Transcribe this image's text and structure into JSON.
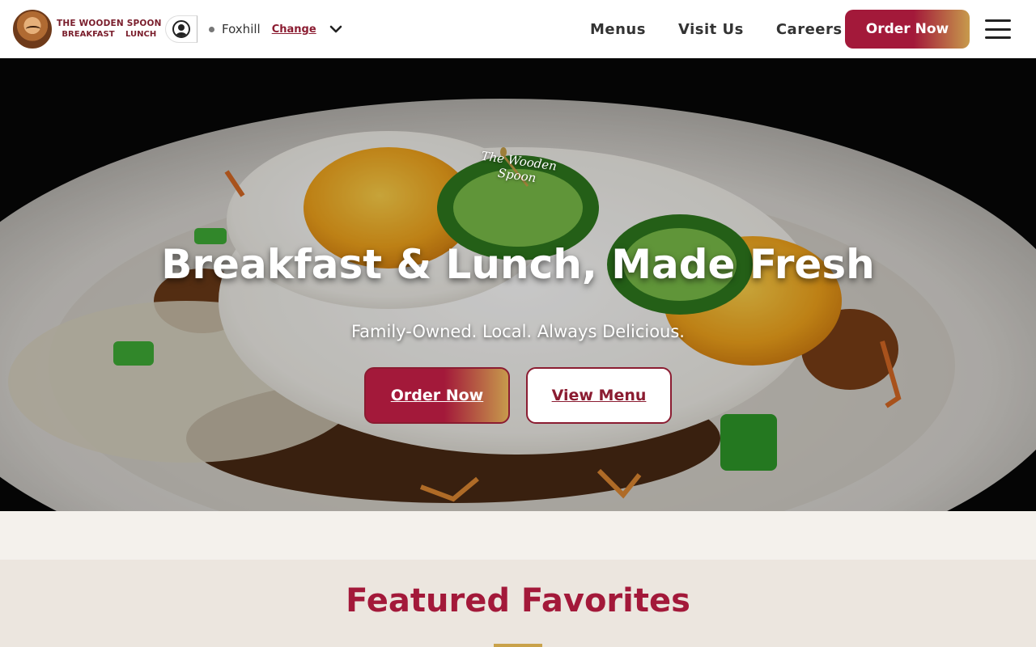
{
  "header": {
    "logo_text_line1": "THE WOODEN SPOON",
    "logo_text_line2": "BREAKFAST LUNCH",
    "location": {
      "name": "Foxhill",
      "change_label": "Change"
    },
    "nav": [
      {
        "label": "Menus"
      },
      {
        "label": "Visit Us"
      },
      {
        "label": "Careers"
      }
    ],
    "order_label": "Order Now"
  },
  "hero": {
    "brand_script": "The Wooden Spoon",
    "title": "Breakfast & Lunch, Made Fresh",
    "subtitle": "Family-Owned. Local. Always Delicious.",
    "primary_label": "Order Now",
    "secondary_label": "View Menu"
  },
  "featured": {
    "title": "Featured Favorites"
  },
  "colors": {
    "brand": "#a3193a",
    "gold": "#c79a4c",
    "cream": "#ece6df"
  }
}
